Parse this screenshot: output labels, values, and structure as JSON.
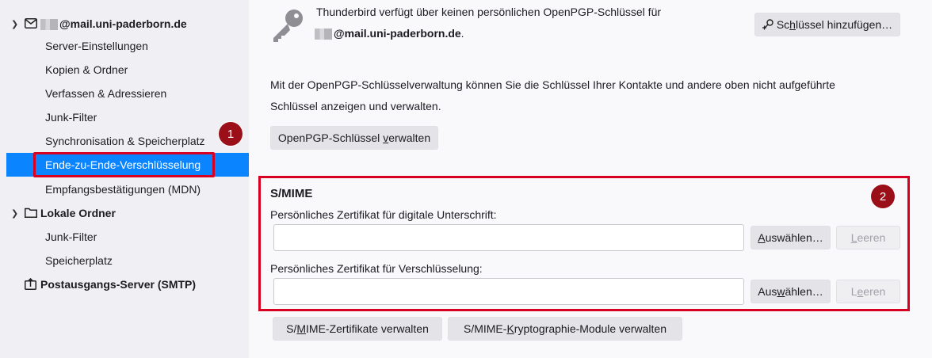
{
  "sidebar": {
    "account": {
      "email_suffix": "@mail.uni-paderborn.de",
      "items": [
        {
          "label": "Server-Einstellungen"
        },
        {
          "label": "Kopien & Ordner"
        },
        {
          "label": "Verfassen & Adressieren"
        },
        {
          "label": "Junk-Filter"
        },
        {
          "label": "Synchronisation & Speicherplatz"
        },
        {
          "label": "Ende-zu-Ende-Verschlüsselung"
        },
        {
          "label": "Empfangsbestätigungen (MDN)"
        }
      ]
    },
    "local_folders": {
      "label": "Lokale Ordner",
      "items": [
        {
          "label": "Junk-Filter"
        },
        {
          "label": "Speicherplatz"
        }
      ]
    },
    "smtp": {
      "label": "Postausgangs-Server (SMTP)"
    }
  },
  "badges": {
    "one": "1",
    "two": "2"
  },
  "openpgp": {
    "no_key_line1": "Thunderbird verfügt über keinen persönlichen OpenPGP-Schlüssel für",
    "no_key_email": "@mail.uni-paderborn.de",
    "no_key_end": ".",
    "add_key_prefix": "Sc",
    "add_key_underline": "h",
    "add_key_suffix": "lüssel hinzufügen…",
    "manage_text_line1": "Mit der OpenPGP-Schlüsselverwaltung können Sie die Schlüssel Ihrer Kontakte und andere oben nicht aufgeführte",
    "manage_text_line2": "Schlüssel anzeigen und verwalten.",
    "manage_btn_prefix": "OpenPGP-Schlüssel ",
    "manage_btn_underline": "v",
    "manage_btn_suffix": "erwalten"
  },
  "smime": {
    "heading": "S/MIME",
    "sign_label": "Persönliches Zertifikat für digitale Unterschrift:",
    "sign_value": "",
    "encrypt_label": "Persönliches Zertifikat für Verschlüsselung:",
    "encrypt_value": "",
    "select1_underline": "A",
    "select1_suffix": "uswählen…",
    "select2_prefix": "Aus",
    "select2_underline": "w",
    "select2_suffix": "ählen…",
    "clear1_underline": "L",
    "clear1_suffix": "eeren",
    "clear2_prefix": "L",
    "clear2_underline": "e",
    "clear2_suffix": "eren",
    "certs_btn_prefix": "S/",
    "certs_btn_underline": "M",
    "certs_btn_suffix": "IME-Zertifikate verwalten",
    "modules_btn_prefix": "S/MIME-",
    "modules_btn_underline": "K",
    "modules_btn_suffix": "ryptographie-Module verwalten"
  }
}
